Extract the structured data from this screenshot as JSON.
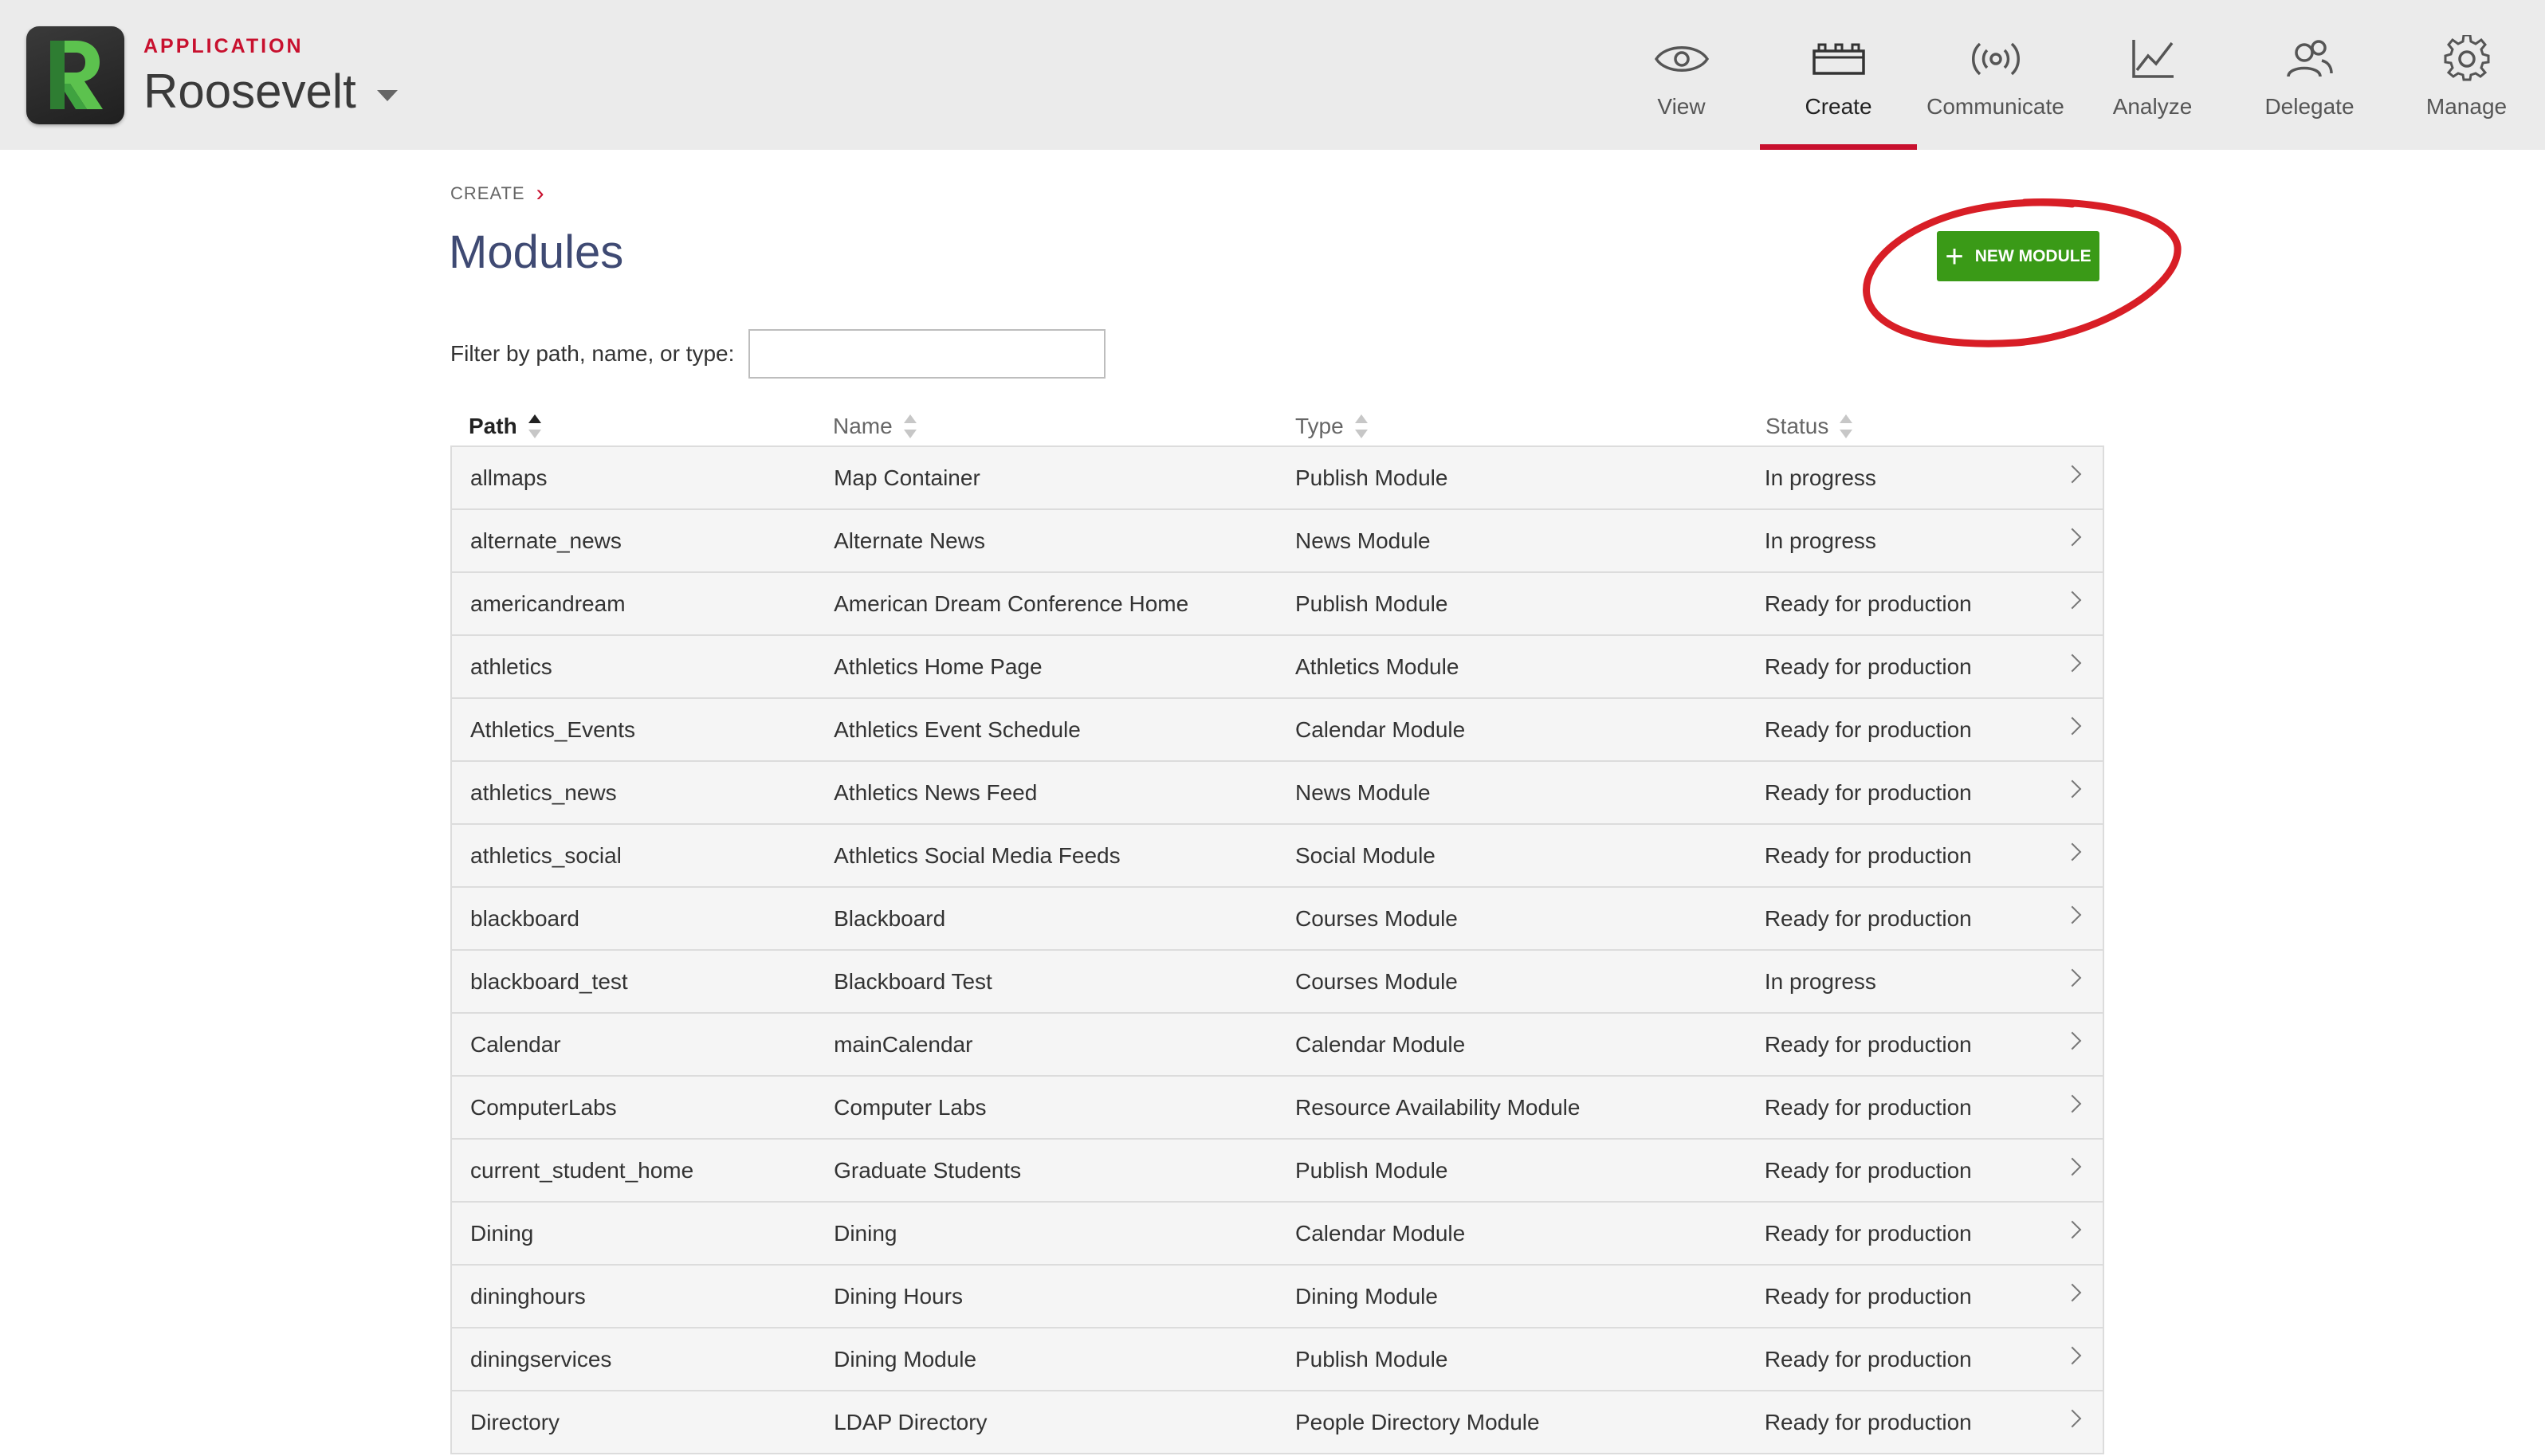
{
  "header": {
    "app_kicker": "APPLICATION",
    "app_name": "Roosevelt",
    "logo_letter": "R",
    "nav": [
      {
        "label": "View",
        "icon": "eye-icon",
        "active": false
      },
      {
        "label": "Create",
        "icon": "blocks-icon",
        "active": true
      },
      {
        "label": "Communicate",
        "icon": "broadcast-icon",
        "active": false
      },
      {
        "label": "Analyze",
        "icon": "line-chart-icon",
        "active": false
      },
      {
        "label": "Delegate",
        "icon": "users-icon",
        "active": false
      },
      {
        "label": "Manage",
        "icon": "gear-icon",
        "active": false
      }
    ]
  },
  "breadcrumb": {
    "root": "CREATE"
  },
  "page": {
    "title": "Modules",
    "new_button_label": "NEW MODULE"
  },
  "filter": {
    "label": "Filter by path, name, or type:",
    "value": "",
    "placeholder": ""
  },
  "table": {
    "columns": [
      "Path",
      "Name",
      "Type",
      "Status"
    ],
    "sorted_column": "Path",
    "rows": [
      [
        "allmaps",
        "Map Container",
        "Publish Module",
        "In progress"
      ],
      [
        "alternate_news",
        "Alternate News",
        "News Module",
        "In progress"
      ],
      [
        "americandream",
        "American Dream Conference Home",
        "Publish Module",
        "Ready for production"
      ],
      [
        "athletics",
        "Athletics Home Page",
        "Athletics Module",
        "Ready for production"
      ],
      [
        "Athletics_Events",
        "Athletics Event Schedule",
        "Calendar Module",
        "Ready for production"
      ],
      [
        "athletics_news",
        "Athletics News Feed",
        "News Module",
        "Ready for production"
      ],
      [
        "athletics_social",
        "Athletics Social Media Feeds",
        "Social Module",
        "Ready for production"
      ],
      [
        "blackboard",
        "Blackboard",
        "Courses Module",
        "Ready for production"
      ],
      [
        "blackboard_test",
        "Blackboard Test",
        "Courses Module",
        "In progress"
      ],
      [
        "Calendar",
        "mainCalendar",
        "Calendar Module",
        "Ready for production"
      ],
      [
        "ComputerLabs",
        "Computer Labs",
        "Resource Availability Module",
        "Ready for production"
      ],
      [
        "current_student_home",
        "Graduate Students",
        "Publish Module",
        "Ready for production"
      ],
      [
        "Dining",
        "Dining",
        "Calendar Module",
        "Ready for production"
      ],
      [
        "dininghours",
        "Dining Hours",
        "Dining Module",
        "Ready for production"
      ],
      [
        "diningservices",
        "Dining Module",
        "Publish Module",
        "Ready for production"
      ],
      [
        "Directory",
        "LDAP Directory",
        "People Directory Module",
        "Ready for production"
      ]
    ]
  },
  "colors": {
    "accent": "#c8102e",
    "button": "#3a9a17",
    "title": "#3f4a73",
    "header_bg": "#ebebeb",
    "annotation": "#d81e26"
  }
}
